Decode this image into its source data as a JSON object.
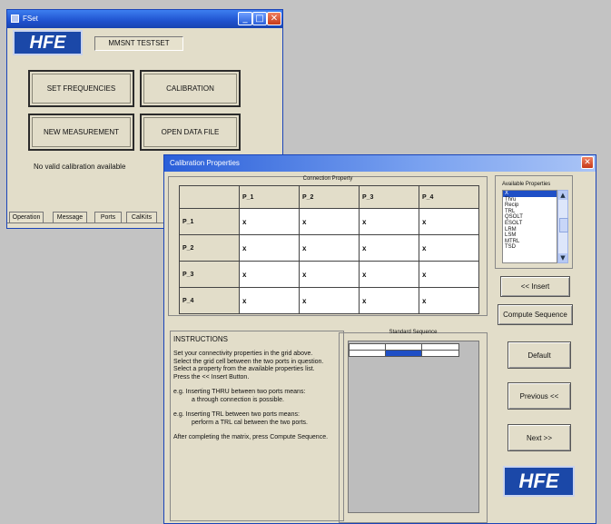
{
  "main_window": {
    "title": "FSet",
    "logo": "HFE",
    "testset_name": "MMSNT TESTSET",
    "buttons": {
      "set_frequencies": "SET FREQUENCIES",
      "calibration": "CALIBRATION",
      "new_measurement": "NEW MEASUREMENT",
      "open_data_file": "OPEN DATA FILE"
    },
    "status": "No valid calibration available",
    "tabs": [
      "Operation",
      "Message",
      "Ports",
      "CalKits"
    ],
    "title_buttons": {
      "minimize": "_",
      "maximize": "□",
      "close": "✕"
    }
  },
  "cal_window": {
    "title": "Calibration Properties",
    "close": "✕",
    "connection_caption": "Connection Property",
    "columns": [
      "P_1",
      "P_2",
      "P_3",
      "P_4"
    ],
    "rows": [
      {
        "label": "P_1",
        "cells": [
          "x",
          "x",
          "x",
          "x"
        ]
      },
      {
        "label": "P_2",
        "cells": [
          "x",
          "x",
          "x",
          "x"
        ]
      },
      {
        "label": "P_3",
        "cells": [
          "x",
          "x",
          "x",
          "x"
        ]
      },
      {
        "label": "P_4",
        "cells": [
          "x",
          "x",
          "x",
          "x"
        ]
      }
    ],
    "available_caption": "Available Properties",
    "available_properties": [
      "X",
      "Thru",
      "Recip",
      "TRL",
      "QSOLT",
      "ESOLT",
      "LRM",
      "LSM",
      "MTRL",
      "TSD"
    ],
    "selected_property": "X",
    "insert_button": "<< Insert",
    "compute_button": "Compute Sequence",
    "instructions_title": "INSTRUCTIONS",
    "instructions": [
      "Set your connectivity properties in the grid above.",
      "Select the grid cell between the two ports in question.",
      "Select a property from the available properties list.",
      "Press the << Insert Button.",
      "e.g. Inserting THRU between two ports means:",
      "a through connection is possible.",
      "e.g. Inserting TRL between two ports means:",
      "perform a TRL cal between the two ports.",
      "After completing the matrix, press Compute Sequence."
    ],
    "sequence_caption": "Standard Sequence",
    "default_button": "Default",
    "previous_button": "Previous <<",
    "next_button": "Next >>",
    "logo": "HFE",
    "colors": {
      "titlebar": "#1f52cf",
      "selection": "#1f4fc6",
      "sequence_highlight": "#1f4fc6"
    }
  }
}
